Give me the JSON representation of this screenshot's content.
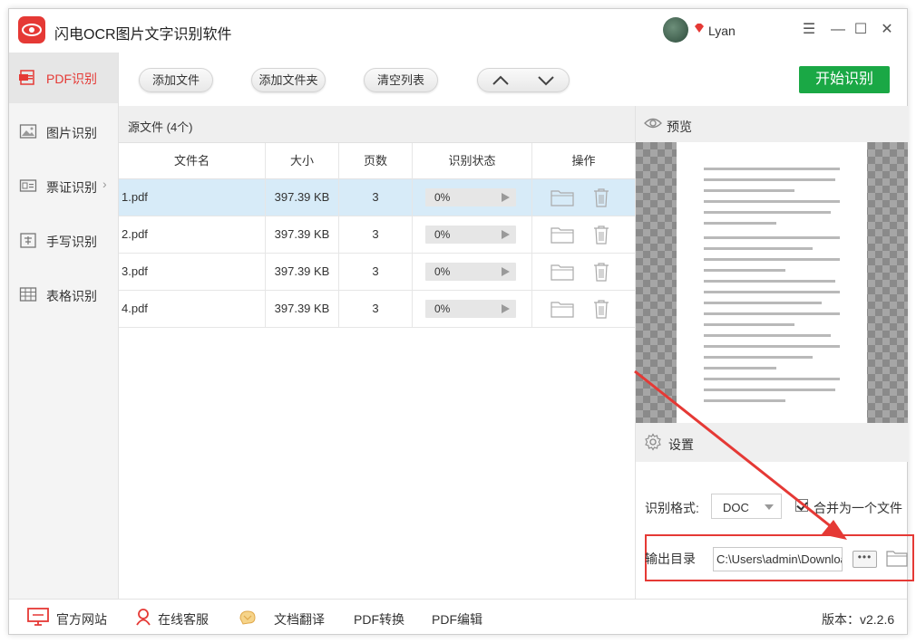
{
  "app": {
    "title": "闪电OCR图片文字识别软件",
    "user": "Lyan",
    "accent_color": "#e53935",
    "green_color": "#1aa845"
  },
  "window_controls": {
    "menu_icon": "menu-icon",
    "minimize_icon": "minimize-icon",
    "maximize_icon": "maximize-icon",
    "close_icon": "close-icon"
  },
  "sidebar": {
    "items": [
      {
        "label": "PDF识别",
        "icon": "pdf-icon",
        "active": true
      },
      {
        "label": "图片识别",
        "icon": "image-icon"
      },
      {
        "label": "票证识别",
        "icon": "ticket-icon"
      },
      {
        "label": "手写识别",
        "icon": "handwriting-icon"
      },
      {
        "label": "表格识别",
        "icon": "table-icon"
      }
    ]
  },
  "toolbar": {
    "add_file": "添加文件",
    "add_folder": "添加文件夹",
    "clear_list": "清空列表",
    "start": "开始识别"
  },
  "files": {
    "header": "源文件 (4个)",
    "columns": [
      "文件名",
      "大小",
      "页数",
      "识别状态",
      "操作"
    ],
    "rows": [
      {
        "name": "1.pdf",
        "size": "397.39 KB",
        "pages": "3",
        "progress": "0%"
      },
      {
        "name": "2.pdf",
        "size": "397.39 KB",
        "pages": "3",
        "progress": "0%"
      },
      {
        "name": "3.pdf",
        "size": "397.39 KB",
        "pages": "3",
        "progress": "0%"
      },
      {
        "name": "4.pdf",
        "size": "397.39 KB",
        "pages": "3",
        "progress": "0%"
      }
    ]
  },
  "preview": {
    "title": "预览"
  },
  "settings": {
    "title": "设置",
    "format_label": "识别格式:",
    "format_value": "DOC",
    "merge_label": "合并为一个文件",
    "merge_checked": true,
    "output_label": "输出目录",
    "output_path": "C:\\Users\\admin\\Downloads",
    "browse": "•••"
  },
  "footer": {
    "website": "官方网站",
    "support": "在线客服",
    "translate": "文档翻译",
    "convert": "PDF转换",
    "edit": "PDF编辑",
    "version": "版本：v2.2.6"
  }
}
